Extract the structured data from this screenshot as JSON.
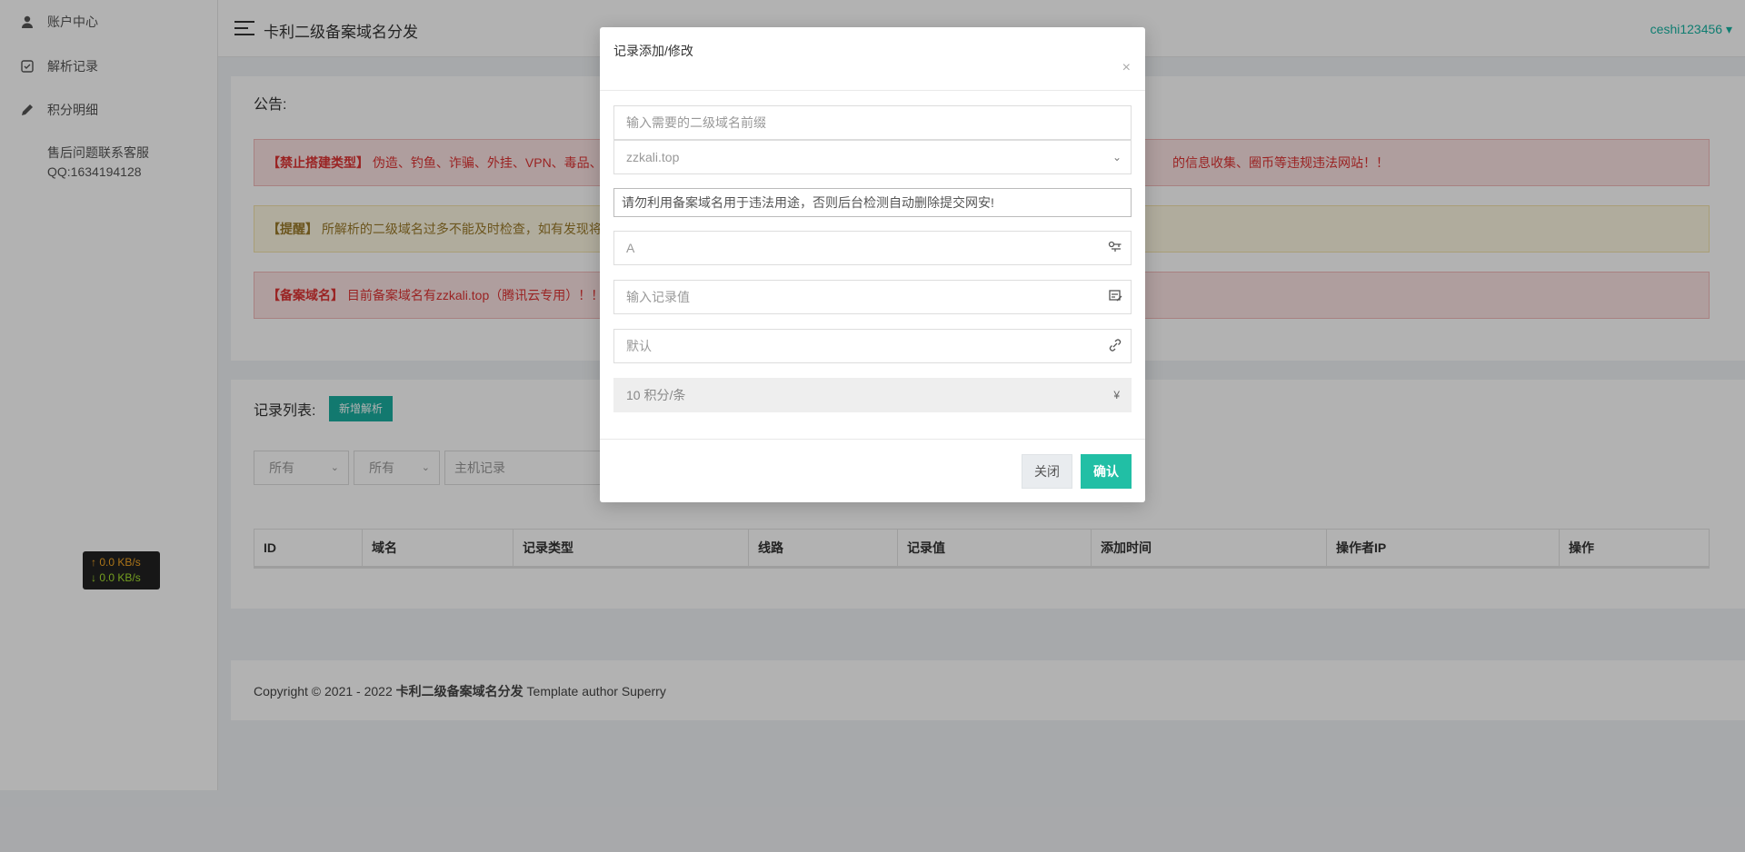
{
  "sidebar": {
    "items": [
      {
        "label": "账户中心"
      },
      {
        "label": "解析记录"
      },
      {
        "label": "积分明细"
      }
    ],
    "contact_line1": "售后问题联系客服",
    "contact_line2": "QQ:1634194128"
  },
  "net_speed": {
    "up": "↑ 0.0 KB/s",
    "down": "↓ 0.0 KB/s"
  },
  "header": {
    "title": "卡利二级备案域名分发",
    "user": "ceshi123456 ▾"
  },
  "notice": {
    "heading": "公告:",
    "alerts": [
      {
        "tag": "【禁止搭建类型】",
        "text": " 伪造、钓鱼、诈骗、外挂、VPN、毒品、",
        "tail": "的信息收集、圈币等违规违法网站！！"
      },
      {
        "tag": "【提醒】",
        "text": " 所解析的二级域名过多不能及时检查，如有发现将",
        "tail": ""
      },
      {
        "tag": "【备案域名】",
        "text": " 目前备案域名有zzkali.top（腾讯云专用）！！",
        "tail": ""
      }
    ]
  },
  "records": {
    "heading": "记录列表:",
    "add_button": "新增解析",
    "filter1": "所有",
    "filter2": "所有",
    "filter_host_placeholder": "主机记录",
    "columns": [
      "ID",
      "域名",
      "记录类型",
      "线路",
      "记录值",
      "添加时间",
      "操作者IP",
      "操作"
    ]
  },
  "footer": {
    "prefix": "Copyright © 2021 - 2022 ",
    "brand": "卡利二级备案域名分发",
    "suffix": " Template author Superry"
  },
  "modal": {
    "title": "记录添加/修改",
    "close_glyph": "×",
    "prefix_placeholder": "输入需要的二级域名前缀",
    "domain_value": "zzkali.top",
    "warning_text": "请勿利用备案域名用于违法用途，否则后台检测自动删除提交网安!",
    "record_type_value": "A",
    "record_value_placeholder": "输入记录值",
    "line_value": "默认",
    "cost_text": "10 积分/条",
    "currency_glyph": "¥",
    "btn_cancel": "关闭",
    "btn_confirm": "确认"
  },
  "colors": {
    "accent": "#1aae9f",
    "confirm": "#21bfa5",
    "danger_bg": "#fbe2e2",
    "warn_bg": "#fdf6e1"
  }
}
